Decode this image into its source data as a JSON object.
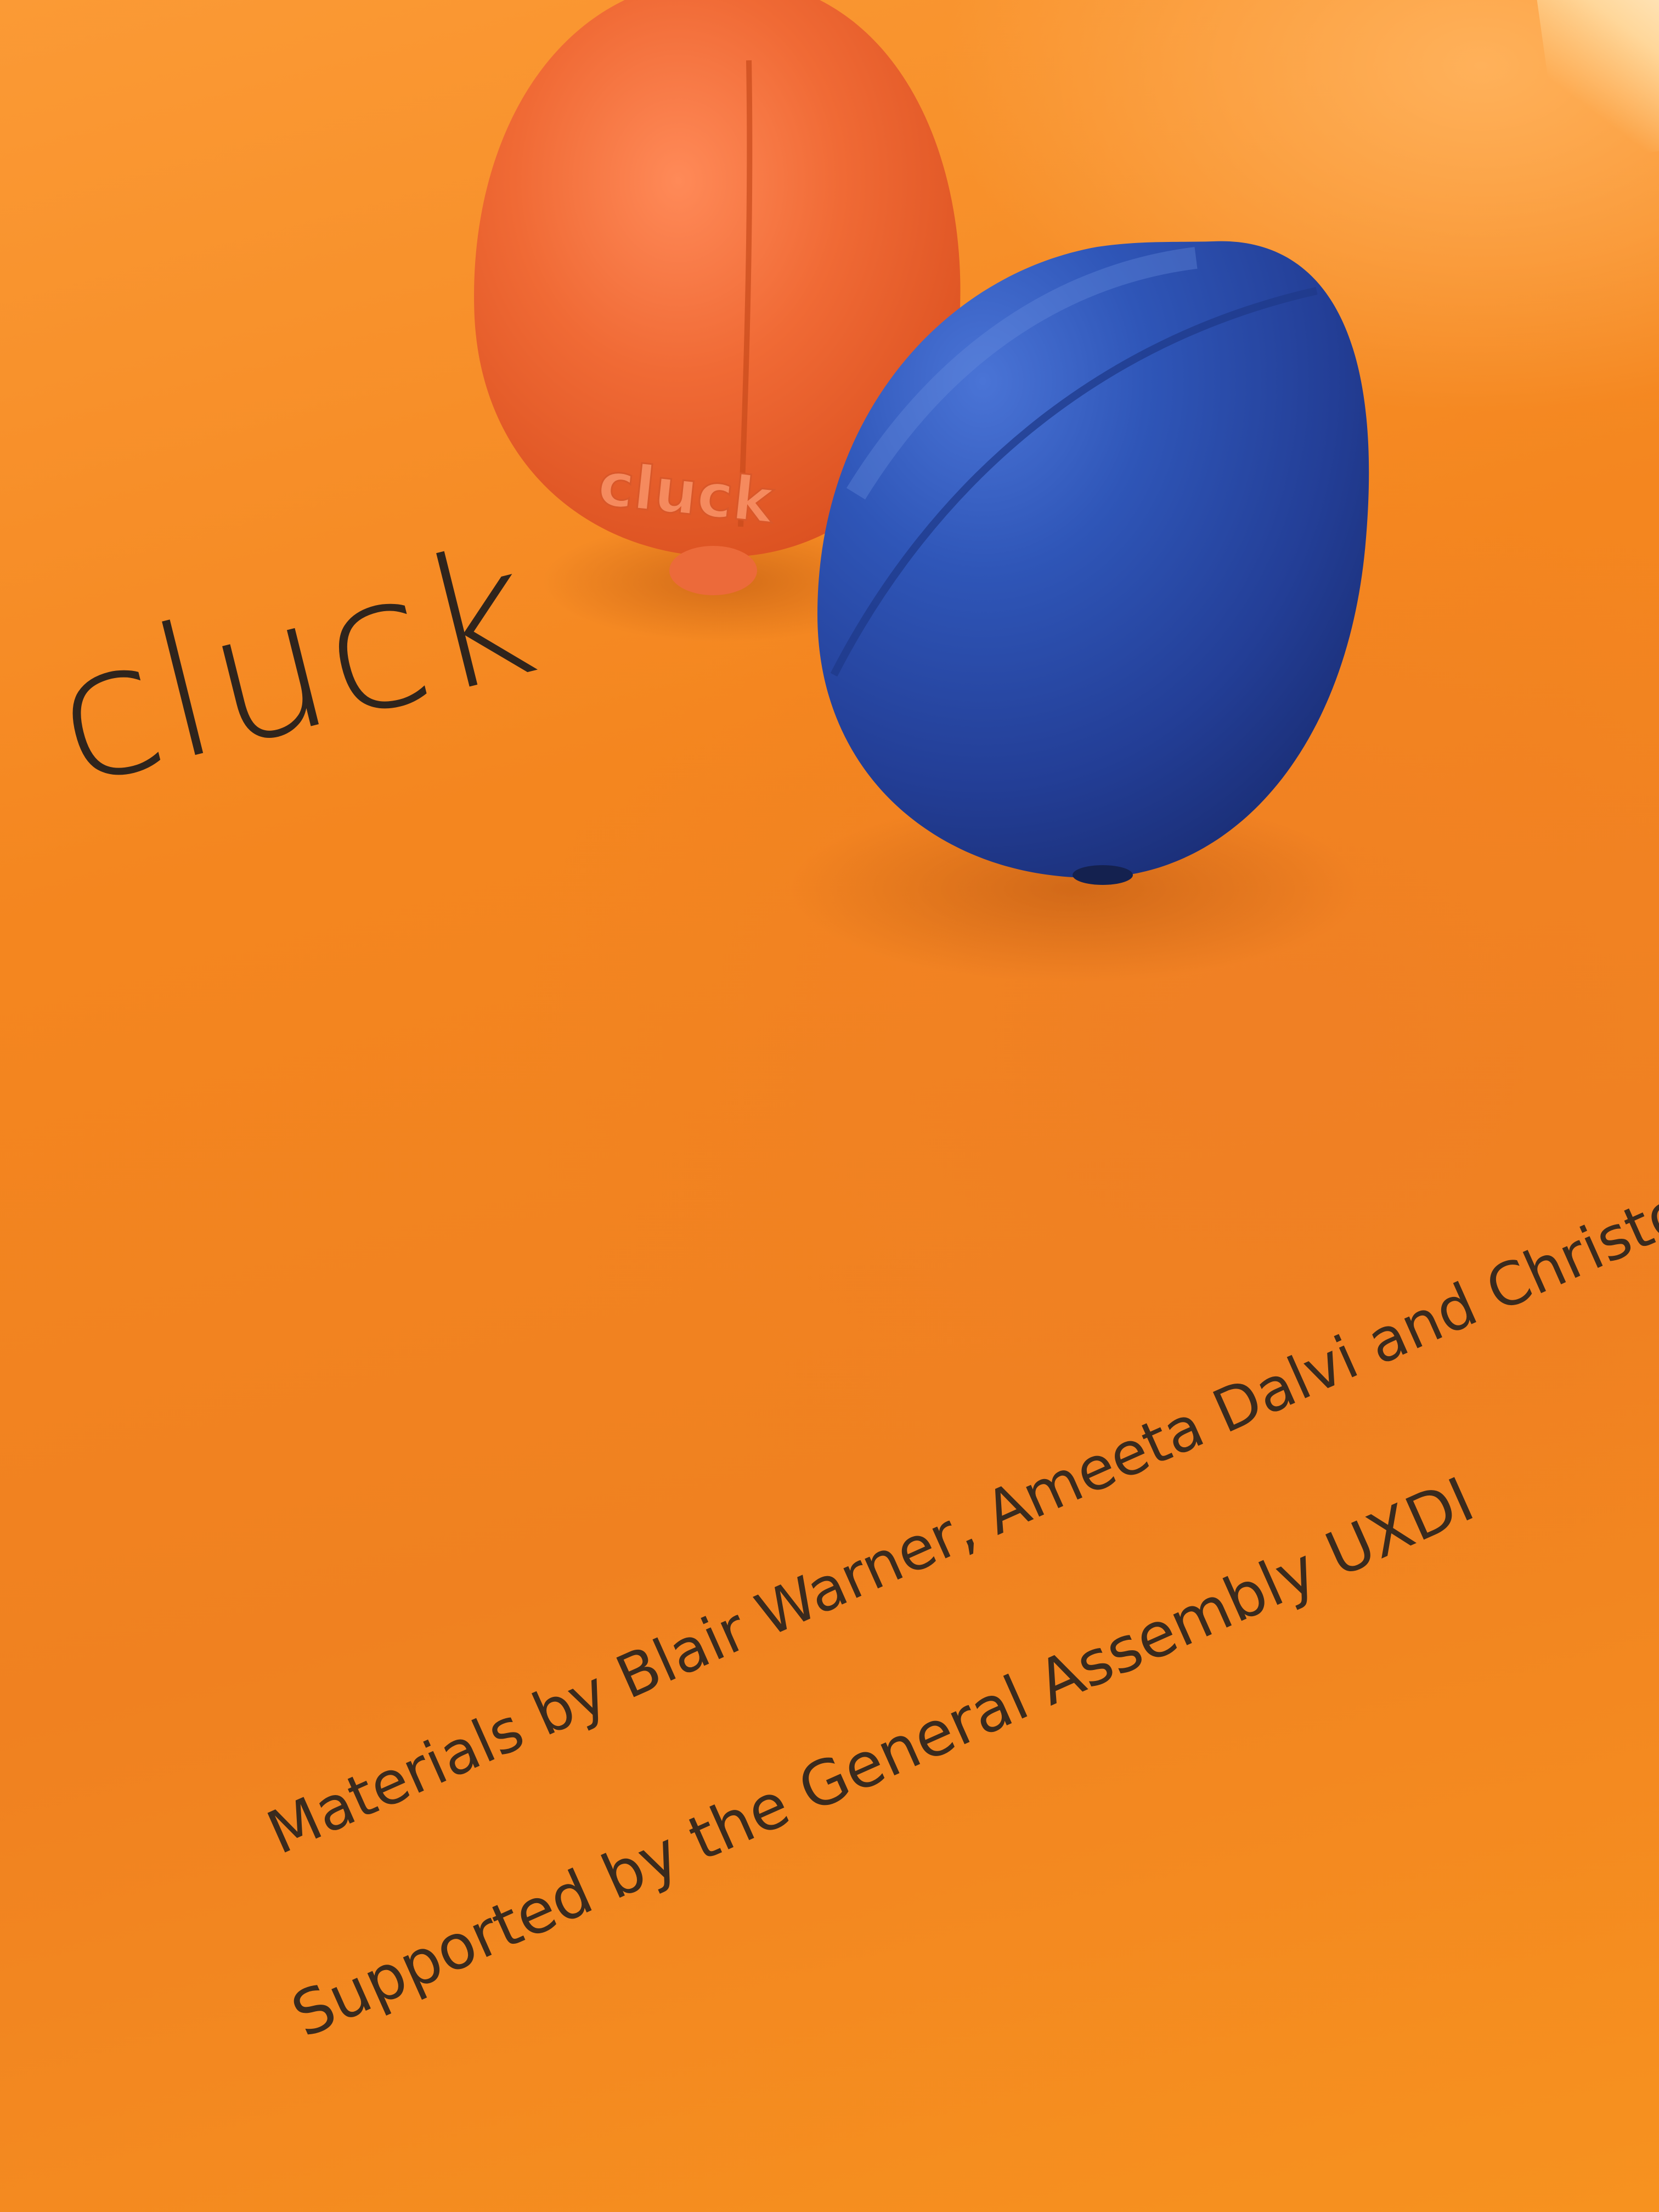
{
  "scene": {
    "background_color": "#f3861f",
    "description_elements": [
      "orange-egg-toy",
      "blue-egg-toy"
    ]
  },
  "cover": {
    "title": "cluck",
    "credit_line_1": "Materials by Blair Warner, Ameeta Dalvi and Christophe",
    "credit_line_2": "Supported by the General Assembly UXDI"
  },
  "orange_egg": {
    "embossed_text": "cluck",
    "color": "#ef6a34"
  },
  "blue_egg": {
    "color": "#2e4fae"
  }
}
